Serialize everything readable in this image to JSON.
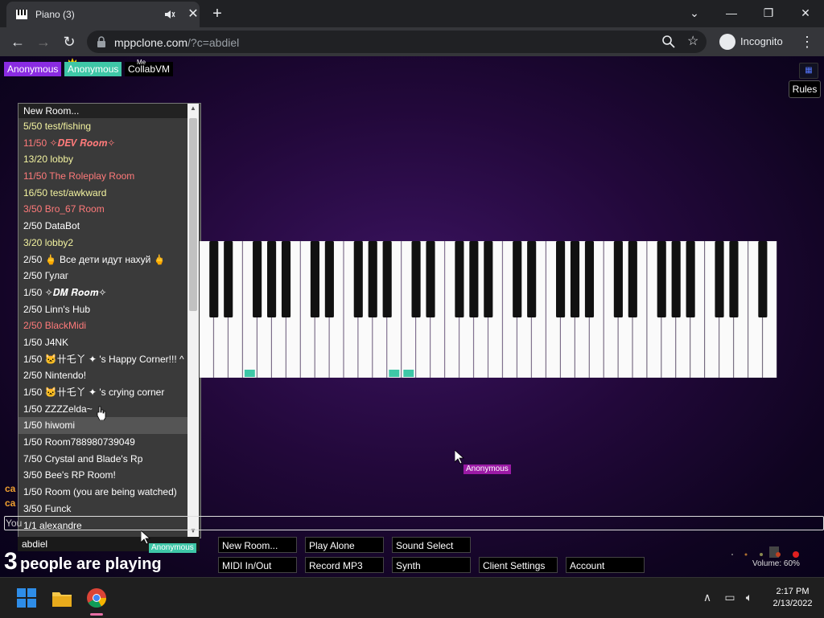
{
  "tab": {
    "title": "Piano (3)"
  },
  "address": {
    "host": "mppclone.com",
    "path": "/?c=abdiel"
  },
  "incognito_label": "Incognito",
  "users": [
    {
      "name": "Anonymous",
      "color": "#8a2be2"
    },
    {
      "name": "Anonymous",
      "color": "#3ec7a7"
    },
    {
      "name": "CollabVM",
      "color": "#000000",
      "tag": "Me"
    }
  ],
  "rules_label": "Rules",
  "room_list": {
    "header": "New Room...",
    "rooms": [
      {
        "label": "5/50 test/fishing",
        "tone": "yellow"
      },
      {
        "label": "11/50 ✧𝑫𝑬𝑽 𝑹𝒐𝒐𝒎✧",
        "tone": "red"
      },
      {
        "label": "13/20 lobby",
        "tone": "yellow"
      },
      {
        "label": "11/50 The Roleplay Room",
        "tone": "red"
      },
      {
        "label": "16/50 test/awkward",
        "tone": "yellow"
      },
      {
        "label": "3/50 Bro_67 Room",
        "tone": "red"
      },
      {
        "label": "2/50 DataBot",
        "tone": "white"
      },
      {
        "label": "3/20 lobby2",
        "tone": "yellow"
      },
      {
        "label": "2/50 🖕 Все дети идут нахуй 🖕",
        "tone": "white"
      },
      {
        "label": "2/50 Гулаг",
        "tone": "white"
      },
      {
        "label": "1/50 ✧𝑫𝑴 𝑹𝒐𝒐𝒎✧",
        "tone": "white"
      },
      {
        "label": "2/50 Linn's Hub",
        "tone": "white"
      },
      {
        "label": "2/50 BlackMidi",
        "tone": "red"
      },
      {
        "label": "1/50 J4NK",
        "tone": "white"
      },
      {
        "label": "1/50 🐱卄乇丫 ✦ 's Happy Corner!!! ^",
        "tone": "white"
      },
      {
        "label": "2/50 Nintendo!",
        "tone": "white"
      },
      {
        "label": "1/50 🐱卄乇丫 ✦ 's crying corner",
        "tone": "white"
      },
      {
        "label": "1/50 ZZZZelda~",
        "tone": "white"
      },
      {
        "label": "1/50 hiwomi",
        "tone": "white",
        "hover": true
      },
      {
        "label": "1/50 Room788980739049",
        "tone": "white"
      },
      {
        "label": "7/50 Crystal and Blade's Rp",
        "tone": "white"
      },
      {
        "label": "3/50 Bee's RP Room!",
        "tone": "white"
      },
      {
        "label": "1/50 Room (you are being watched)",
        "tone": "white"
      },
      {
        "label": "3/50 Funck",
        "tone": "white"
      },
      {
        "label": "1/1 alexandre",
        "tone": "white"
      }
    ]
  },
  "cursor_labels": [
    "Anonymous",
    "Anonymous"
  ],
  "chat": {
    "line1": "ca",
    "line2": "ca",
    "input_prefix": "You"
  },
  "name_field": "abdiel",
  "playing": {
    "count": "3",
    "text": "people are playing"
  },
  "controls": [
    "New Room...",
    "Play Alone",
    "Sound Select",
    "MIDI In/Out",
    "Record MP3",
    "Synth",
    "Client Settings",
    "Account"
  ],
  "volume": "Volume: 60%",
  "clock": {
    "time": "2:17 PM",
    "date": "2/13/2022"
  },
  "colors": {
    "accent": "#3ec7a7",
    "purple": "#8a2be2"
  }
}
